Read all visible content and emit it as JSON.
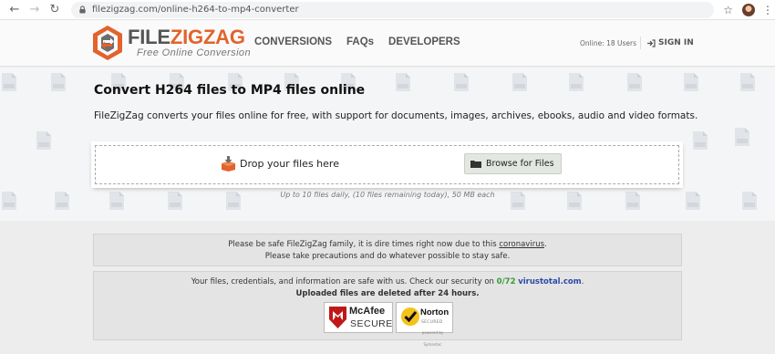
{
  "browser": {
    "url": "filezigzag.com/online-h264-to-mp4-converter",
    "back_icon": "arrow-left-icon",
    "forward_icon": "arrow-right-icon",
    "reload_icon": "reload-icon"
  },
  "header": {
    "logo_part1": "FILE",
    "logo_part2": "ZIGZAG",
    "tagline": "Free Online Conversion",
    "nav": [
      "CONVERSIONS",
      "FAQs",
      "DEVELOPERS"
    ],
    "online_text": "Online: 18 Users",
    "signin_label": "SIGN IN"
  },
  "hero": {
    "title": "Convert H264 files to MP4 files online",
    "subtitle": "FileZigZag converts your files online for free, with support for documents, images, archives, ebooks, audio and video formats.",
    "drop_label": "Drop your files here",
    "browse_label": "Browse for Files",
    "limits": "Up to 10 files daily, (10 files remaining today), 50 MB each"
  },
  "notice1": {
    "line1_prefix": "Please be safe FileZigZag family, it is dire times right now due to this ",
    "line1_link": "coronavirus",
    "line1_suffix": ".",
    "line2": "Please take precautions and do whatever possible to stay safe."
  },
  "notice2": {
    "line1_prefix": "Your files, credentials, and information are safe with us. Check our security on ",
    "score": "0/72",
    "vt_link": "virustotal.com",
    "line1_suffix": ".",
    "line2": "Uploaded files are deleted after 24 hours."
  },
  "badges": {
    "mcafee_name": "McAfee",
    "mcafee_secure": "SECURE",
    "norton_name": "Norton",
    "norton_sub": "SECURED",
    "norton_by": "powered by Symantec"
  },
  "colors": {
    "brand_orange": "#e2632b",
    "logo_gray": "#555555",
    "green": "#3a9a3a",
    "link_blue": "#2a4aa8"
  }
}
